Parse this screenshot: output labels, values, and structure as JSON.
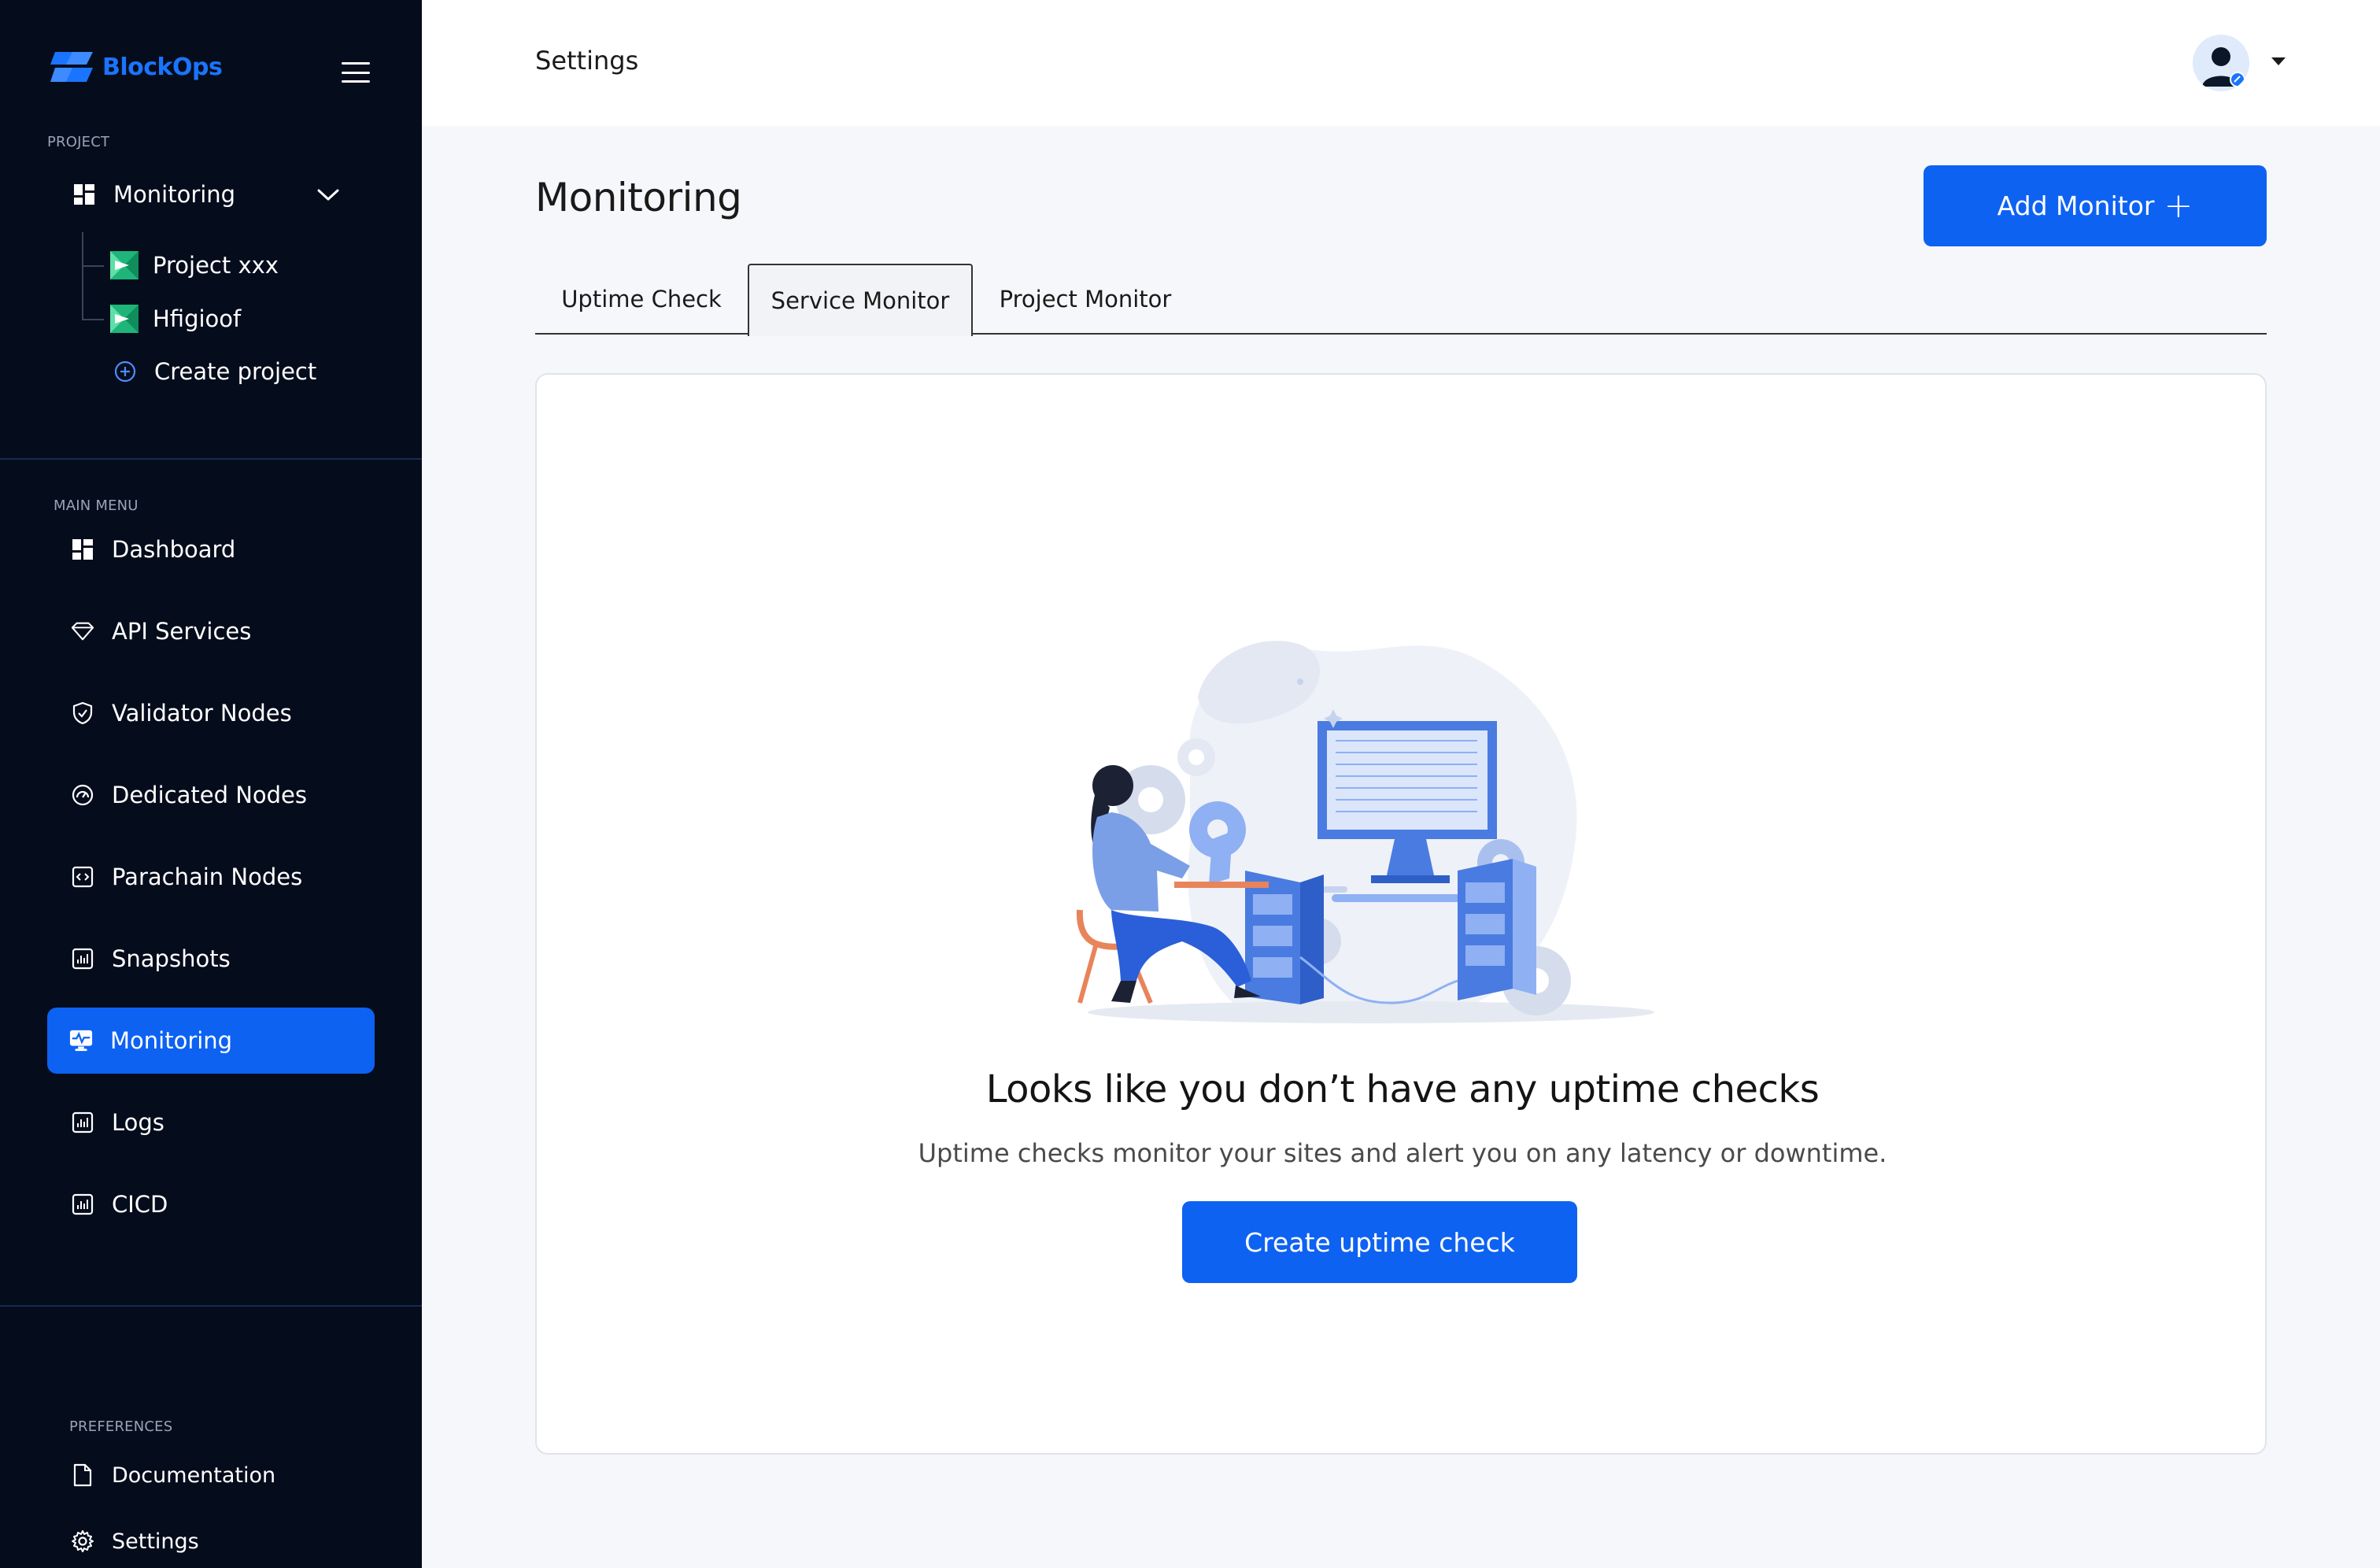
{
  "brand": {
    "name": "BlockOps",
    "logo_icon": "blockops-logo-icon",
    "accent": "#1a74ff"
  },
  "sidebar": {
    "project_label": "PROJECT",
    "project_dropdown": {
      "label": "Monitoring",
      "icon": "grid-icon"
    },
    "projects": [
      {
        "label": "Project xxx",
        "icon": "project-flag-icon"
      },
      {
        "label": "Hfigioof",
        "icon": "project-flag-icon"
      }
    ],
    "create_project": {
      "label": "Create project",
      "icon": "plus-circle-icon"
    },
    "main_menu_label": "MAIN MENU",
    "menu": [
      {
        "label": "Dashboard",
        "icon": "grid-icon"
      },
      {
        "label": "API Services",
        "icon": "diamond-icon"
      },
      {
        "label": "Validator Nodes",
        "icon": "shield-icon"
      },
      {
        "label": "Dedicated Nodes",
        "icon": "gauge-icon"
      },
      {
        "label": "Parachain Nodes",
        "icon": "code-box-icon"
      },
      {
        "label": "Snapshots",
        "icon": "chart-box-icon"
      },
      {
        "label": "Monitoring",
        "icon": "monitor-pulse-icon",
        "active": true
      },
      {
        "label": "Logs",
        "icon": "chart-box-icon"
      },
      {
        "label": "CICD",
        "icon": "chart-box-icon"
      }
    ],
    "preferences_label": "PREFERENCES",
    "preferences": [
      {
        "label": "Documentation",
        "icon": "document-icon"
      },
      {
        "label": "Settings",
        "icon": "gear-icon"
      }
    ]
  },
  "header": {
    "title": "Settings",
    "avatar_icon": "user-avatar-icon"
  },
  "main": {
    "title": "Monitoring",
    "add_button": {
      "label": "Add Monitor",
      "icon": "plus-icon"
    },
    "tabs": [
      {
        "label": "Uptime Check"
      },
      {
        "label": "Service Monitor",
        "selected": true
      },
      {
        "label": "Project Monitor"
      }
    ],
    "empty_state": {
      "title": "Looks like you don’t have any uptime checks",
      "subtitle": "Uptime checks monitor your sites and alert you on any latency or downtime.",
      "button_label": "Create uptime check",
      "illustration": "person-at-computer-servers-illustration"
    }
  },
  "colors": {
    "primary": "#0d62f2",
    "sidebar_bg": "#050c1c",
    "page_bg": "#f6f7fa"
  }
}
